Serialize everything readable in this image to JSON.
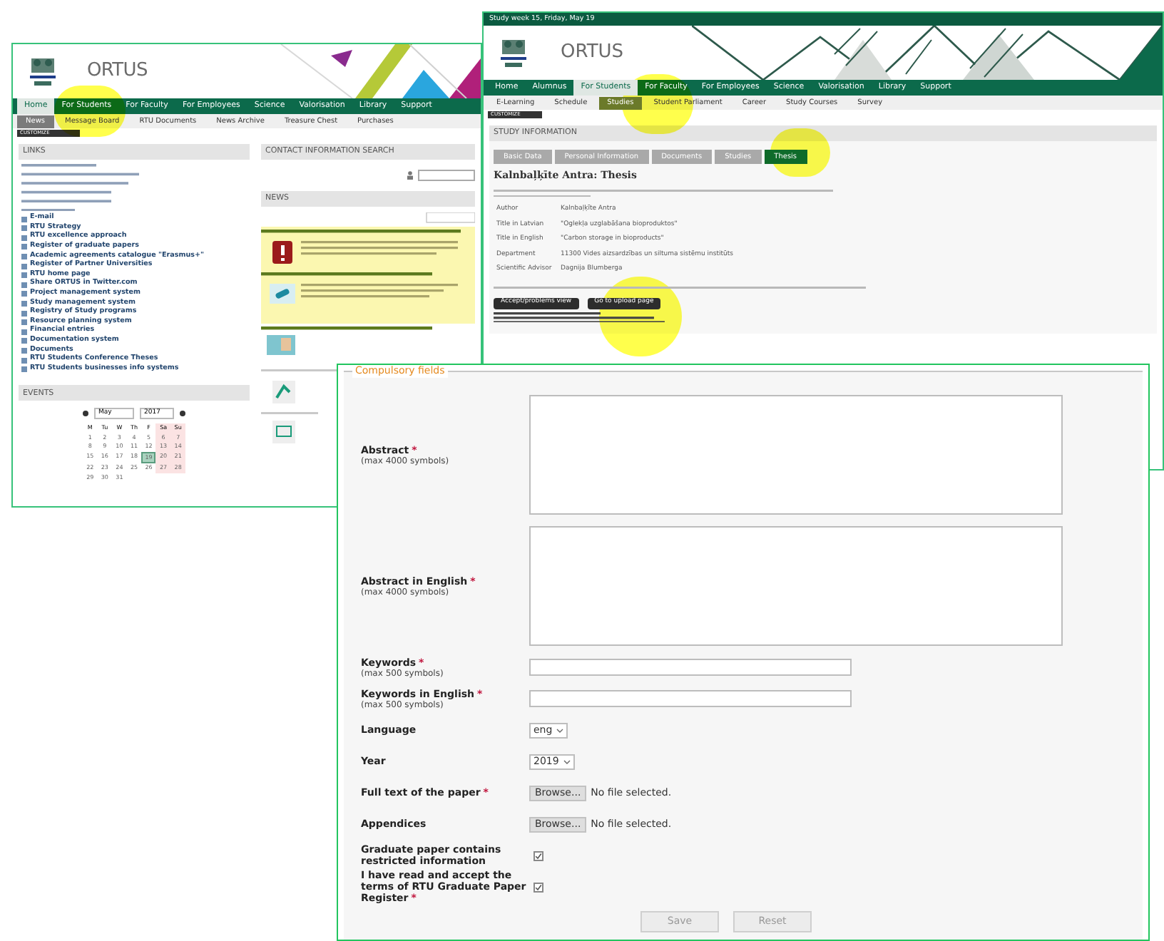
{
  "left_portal": {
    "brand": "ORTUS",
    "nav": [
      {
        "label": "Home",
        "selected": true
      },
      {
        "label": "For Students",
        "selected": false
      },
      {
        "label": "For Faculty",
        "selected": false
      },
      {
        "label": "For Employees",
        "selected": false
      },
      {
        "label": "Science",
        "selected": false
      },
      {
        "label": "Valorisation",
        "selected": false
      },
      {
        "label": "Library",
        "selected": false
      },
      {
        "label": "Support",
        "selected": false
      }
    ],
    "subnav": [
      {
        "label": "News",
        "selected": true
      },
      {
        "label": "Message Board",
        "selected": false
      },
      {
        "label": "RTU Documents",
        "selected": false
      },
      {
        "label": "News Archive",
        "selected": false
      },
      {
        "label": "Treasure Chest",
        "selected": false
      },
      {
        "label": "Purchases",
        "selected": false
      }
    ],
    "customize": "CUSTOMIZE",
    "links": {
      "title": "LINKS",
      "items": [
        "E-mail",
        "RTU Strategy",
        "RTU excellence approach",
        "Register of graduate papers",
        "Academic agreements catalogue \"Erasmus+\"",
        "Register of Partner Universities",
        "RTU home page",
        "Share ORTUS in Twitter.com",
        "Project management system",
        "Study management system",
        "Registry of Study programs",
        "Resource planning system",
        "Financial entries",
        "Documentation system",
        "Documents",
        "RTU Students Conference Theses",
        "RTU Students businesses info systems"
      ]
    },
    "events": {
      "title": "EVENTS",
      "month": "May",
      "year": "2017",
      "weekdays": [
        "M",
        "Tu",
        "W",
        "Th",
        "F",
        "Sa",
        "Su"
      ],
      "days": [
        {
          "label": "1",
          "selected": false
        },
        {
          "label": "2",
          "selected": false
        },
        {
          "label": "3",
          "selected": false
        },
        {
          "label": "4",
          "selected": false
        },
        {
          "label": "5",
          "selected": false
        },
        {
          "label": "6",
          "selected": false
        },
        {
          "label": "7",
          "selected": false
        },
        {
          "label": "8",
          "selected": false
        },
        {
          "label": "9",
          "selected": false
        },
        {
          "label": "10",
          "selected": false
        },
        {
          "label": "11",
          "selected": false
        },
        {
          "label": "12",
          "selected": false
        },
        {
          "label": "13",
          "selected": false
        },
        {
          "label": "14",
          "selected": false
        },
        {
          "label": "15",
          "selected": false
        },
        {
          "label": "16",
          "selected": false
        },
        {
          "label": "17",
          "selected": false
        },
        {
          "label": "18",
          "selected": false
        },
        {
          "label": "19",
          "selected": true
        },
        {
          "label": "20",
          "selected": false
        },
        {
          "label": "21",
          "selected": false
        },
        {
          "label": "22",
          "selected": false
        },
        {
          "label": "23",
          "selected": false
        },
        {
          "label": "24",
          "selected": false
        },
        {
          "label": "25",
          "selected": false
        },
        {
          "label": "26",
          "selected": false
        },
        {
          "label": "27",
          "selected": false
        },
        {
          "label": "28",
          "selected": false
        },
        {
          "label": "29",
          "selected": false
        },
        {
          "label": "30",
          "selected": false
        },
        {
          "label": "31",
          "selected": false
        }
      ]
    },
    "contact_search": {
      "title": "CONTACT INFORMATION SEARCH"
    },
    "news": {
      "title": "NEWS"
    }
  },
  "right_portal": {
    "status": "Study week 15, Friday, May 19",
    "brand": "ORTUS",
    "nav": [
      {
        "label": "Home",
        "selected": false
      },
      {
        "label": "Alumnus",
        "selected": false
      },
      {
        "label": "For Students",
        "selected": true
      },
      {
        "label": "For Faculty",
        "selected": false
      },
      {
        "label": "For Employees",
        "selected": false
      },
      {
        "label": "Science",
        "selected": false
      },
      {
        "label": "Valorisation",
        "selected": false
      },
      {
        "label": "Library",
        "selected": false
      },
      {
        "label": "Support",
        "selected": false
      }
    ],
    "subnav": [
      {
        "label": "E-Learning",
        "selected": false
      },
      {
        "label": "Schedule",
        "selected": false
      },
      {
        "label": "Studies",
        "selected": true
      },
      {
        "label": "Student Parliament",
        "selected": false
      },
      {
        "label": "Career",
        "selected": false
      },
      {
        "label": "Study Courses",
        "selected": false
      },
      {
        "label": "Survey",
        "selected": false
      }
    ],
    "customize": "CUSTOMIZE",
    "section_title": "STUDY INFORMATION",
    "tabs": [
      {
        "label": "Basic Data",
        "selected": false
      },
      {
        "label": "Personal Information",
        "selected": false
      },
      {
        "label": "Documents",
        "selected": false
      },
      {
        "label": "Studies",
        "selected": false
      },
      {
        "label": "Thesis",
        "selected": true
      }
    ],
    "heading": "Kalnbaļķīte Antra: Thesis",
    "details": [
      {
        "label": "Author",
        "value": "Kalnbaļķīte Antra"
      },
      {
        "label": "Title in Latvian",
        "value": "\"Oglekļa uzglabāšana bioproduktos\""
      },
      {
        "label": "Title in English",
        "value": "\"Carbon storage in bioproducts\""
      },
      {
        "label": "Department",
        "value": "11300 Vides aizsardzības un siltuma sistēmu institūts"
      },
      {
        "label": "Scientific Advisor",
        "value": "Dagnija Blumberga"
      }
    ],
    "buttons": [
      "Accept/problems view",
      "Go to upload page"
    ]
  },
  "form": {
    "legend": "Compulsory fields",
    "required_mark": "*",
    "fields": [
      {
        "kind": "textarea",
        "label": "Abstract",
        "hint": "(max 4000 symbols)",
        "required": true
      },
      {
        "kind": "textarea",
        "label": "Abstract in English",
        "hint": "(max 4000 symbols)",
        "required": true
      },
      {
        "kind": "text",
        "label": "Keywords",
        "hint": "(max 500 symbols)",
        "required": true
      },
      {
        "kind": "text",
        "label": "Keywords in English",
        "hint": "(max 500 symbols)",
        "required": true
      },
      {
        "kind": "select",
        "label": "Language",
        "value": "eng",
        "required": false
      },
      {
        "kind": "select",
        "label": "Year",
        "value": "2019",
        "required": false
      },
      {
        "kind": "file",
        "label": "Full text of the paper",
        "button": "Browse...",
        "status": "No file selected.",
        "required": true
      },
      {
        "kind": "file",
        "label": "Appendices",
        "button": "Browse...",
        "status": "No file selected.",
        "required": false
      },
      {
        "kind": "checkbox",
        "label": "Graduate paper contains restricted information",
        "checked": true,
        "required": false
      },
      {
        "kind": "checkbox",
        "label": "I have read and accept the terms of RTU Graduate Paper Register",
        "checked": true,
        "required": true
      }
    ],
    "buttons": [
      "Save",
      "Reset"
    ]
  }
}
